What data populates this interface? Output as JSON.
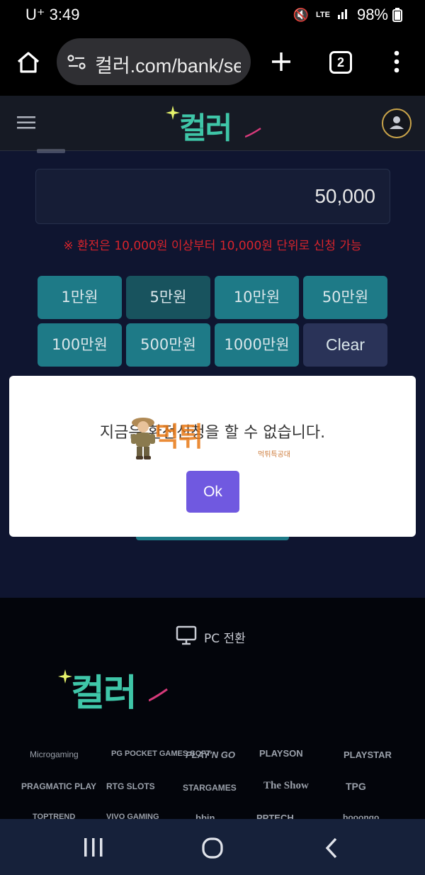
{
  "status_bar": {
    "carrier": "U⁺",
    "time": "3:49",
    "network": "LTE",
    "battery": "98%"
  },
  "browser": {
    "url": "컬러.com/bank/se",
    "tab_count": "2"
  },
  "site": {
    "logo": "컬러"
  },
  "form": {
    "amount": "50,000",
    "notice": "※ 환전은 10,000원 이상부터 10,000원 단위로 신청 가능",
    "amount_buttons": [
      "1만원",
      "5만원",
      "10만원",
      "50만원",
      "100만원",
      "500만원",
      "1000만원",
      "Clear"
    ]
  },
  "modal": {
    "message": "지금은 환전신청을 할 수 없습니다.",
    "ok_label": "Ok"
  },
  "watermark": {
    "text": "먹튀",
    "sub": "먹튀특공대"
  },
  "footer": {
    "pc_switch": "PC 전환",
    "logo": "컬러",
    "providers": [
      "Microgaming",
      "PG POCKET GAMES SOFT",
      "PLAY'N GO",
      "PLAYSON",
      "PLAYSTAR",
      "PRAGMATIC PLAY",
      "RTG SLOTS",
      "STARGAMES",
      "The Show",
      "TPG",
      "TOPTREND",
      "VIVO GAMING",
      "bbin",
      "PPTECH",
      "booongo"
    ]
  },
  "colors": {
    "accent_teal": "#1e7a87",
    "notice_red": "#d7242c",
    "ok_purple": "#7059e0",
    "page_bg": "#0f1530"
  }
}
